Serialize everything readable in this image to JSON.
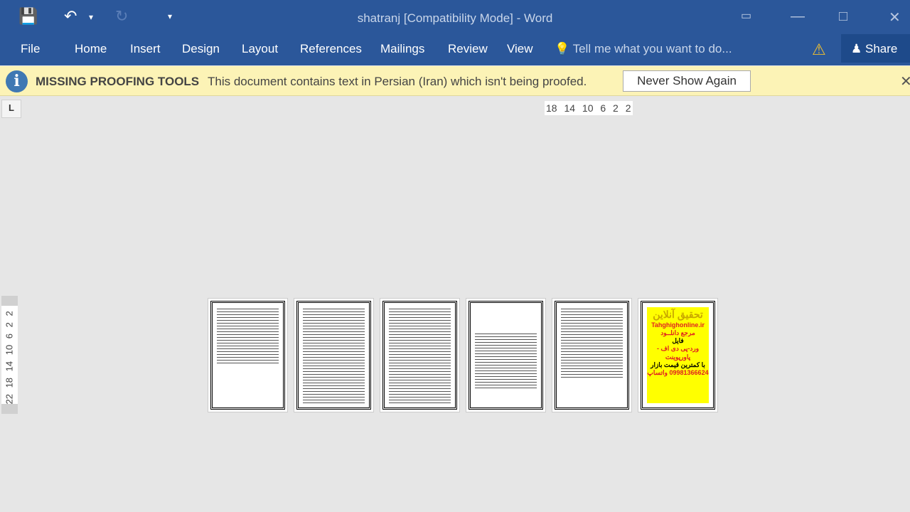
{
  "titlebar": {
    "title": "shatranj [Compatibility Mode] - Word",
    "icons": [
      "save-icon",
      "undo-icon",
      "undo-dropdown-icon",
      "redo-icon",
      "customize-qat-icon",
      "ribbon-display-icon",
      "minimize-icon",
      "maximize-icon",
      "close-icon"
    ]
  },
  "menu": {
    "tabs": [
      "File",
      "Home",
      "Insert",
      "Design",
      "Layout",
      "References",
      "Mailings",
      "Review",
      "View"
    ],
    "tell_me": "Tell me what you want to do...",
    "share": "Share"
  },
  "infobar": {
    "title": "MISSING PROOFING TOOLS",
    "message": "This document contains text in Persian (Iran) which isn't being proofed.",
    "button": "Never Show Again"
  },
  "rulers": {
    "horizontal": "18 14 10 6 2 2",
    "vertical": "22 18 14 10 6 2 2",
    "tab_stop": "L"
  },
  "ad_page": {
    "line1": "تحقیق آنلاین",
    "line2": "Tahghighonline.ir",
    "line3": "مرجع دانلــود",
    "line4": "فایل",
    "line5": "ورد-پی دی اف - پاورپوینت",
    "line6": "با کمترین قیمت بازار",
    "line7": "09981366624 واتساپ"
  }
}
